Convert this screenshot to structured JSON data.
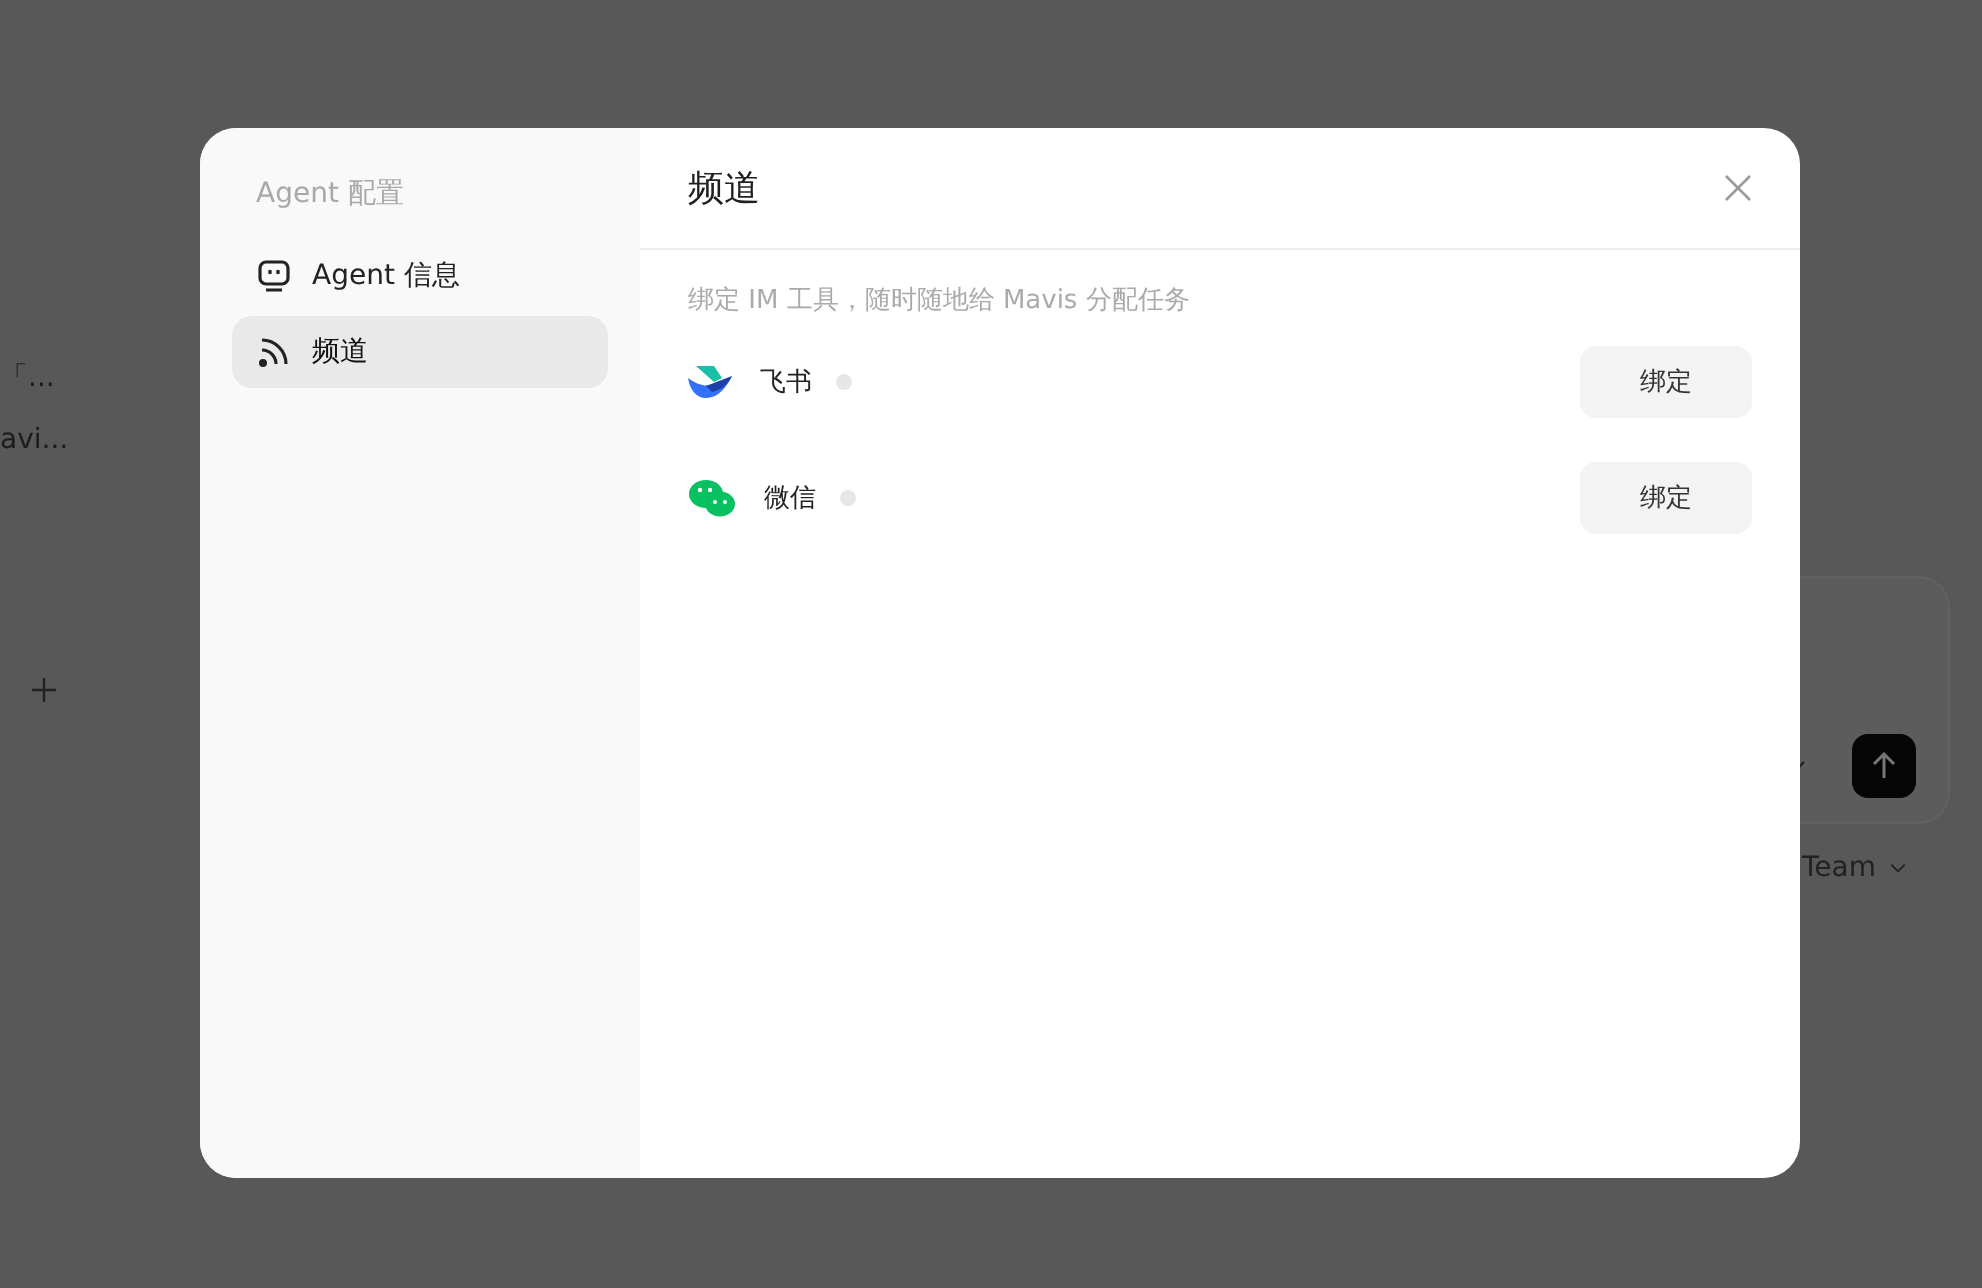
{
  "background": {
    "sidebar_items": [
      "「...",
      "avi..."
    ],
    "team_selector": "Team"
  },
  "dialog": {
    "nav_title": "Agent 配置",
    "nav_items": [
      {
        "label": "Agent 信息",
        "kind": "bot",
        "selected": false
      },
      {
        "label": "频道",
        "kind": "feed",
        "selected": true
      }
    ],
    "title": "频道",
    "subtitle": "绑定 IM 工具，随时随地给 Mavis 分配任务",
    "channels": [
      {
        "name": "飞书",
        "kind": "feishu",
        "online": false,
        "button": "绑定"
      },
      {
        "name": "微信",
        "kind": "wechat",
        "online": false,
        "button": "绑定"
      }
    ]
  }
}
